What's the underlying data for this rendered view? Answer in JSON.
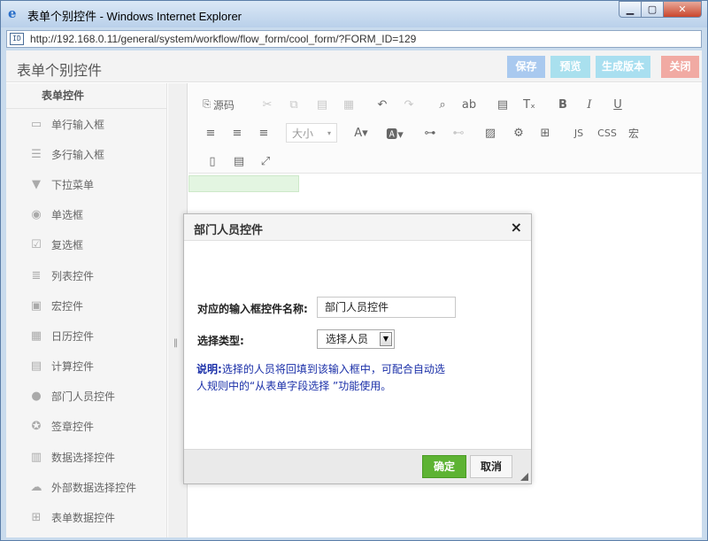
{
  "window": {
    "title": "表单个别控件 - Windows Internet Explorer",
    "url": "http://192.168.0.11/general/system/workflow/flow_form/cool_form/?FORM_ID=129"
  },
  "header": {
    "title": "表单个别控件",
    "buttons": {
      "save": "保存",
      "preview": "预览",
      "generate": "生成版本",
      "close": "关闭"
    }
  },
  "sidebar": {
    "heading": "表单控件",
    "items": [
      {
        "label": "单行输入框",
        "icon": "textbox-icon"
      },
      {
        "label": "多行输入框",
        "icon": "textarea-icon"
      },
      {
        "label": "下拉菜单",
        "icon": "dropdown-icon"
      },
      {
        "label": "单选框",
        "icon": "radio-icon"
      },
      {
        "label": "复选框",
        "icon": "checkbox-icon"
      },
      {
        "label": "列表控件",
        "icon": "list-icon"
      },
      {
        "label": "宏控件",
        "icon": "macro-icon"
      },
      {
        "label": "日历控件",
        "icon": "calendar-icon"
      },
      {
        "label": "计算控件",
        "icon": "calculator-icon"
      },
      {
        "label": "部门人员控件",
        "icon": "user-icon"
      },
      {
        "label": "签章控件",
        "icon": "seal-icon"
      },
      {
        "label": "数据选择控件",
        "icon": "data-select-icon"
      },
      {
        "label": "外部数据选择控件",
        "icon": "cloud-icon"
      },
      {
        "label": "表单数据控件",
        "icon": "form-data-icon"
      }
    ]
  },
  "toolbar": {
    "source_label": "源码",
    "font_size_label": "大小",
    "js_label": "JS",
    "css_label": "CSS",
    "macro_label": "宏"
  },
  "dialog": {
    "title": "部门人员控件",
    "name_label": "对应的输入框控件名称:",
    "name_value": "部门人员控件",
    "type_label": "选择类型:",
    "type_value": "选择人员",
    "note_prefix": "说明:",
    "note_text": "选择的人员将回填到该输入框中，可配合自动选人规则中的“从表单字段选择 ”功能使用。",
    "ok_label": "确定",
    "cancel_label": "取消"
  }
}
